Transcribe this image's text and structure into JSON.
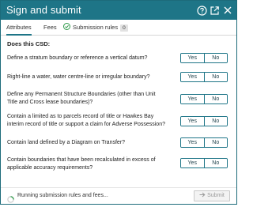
{
  "dialog": {
    "title": "Sign and submit",
    "title_icons": [
      "help-icon",
      "open-external-icon",
      "close-icon"
    ]
  },
  "tabs": [
    {
      "label": "Attributes",
      "active": true
    },
    {
      "label": "Fees",
      "active": false
    },
    {
      "label": "Submission rules",
      "active": false,
      "badge": "0",
      "icon": "check-circle-icon"
    }
  ],
  "section_label": "Does this CSD:",
  "yes_label": "Yes",
  "no_label": "No",
  "questions": [
    {
      "text": "Define a stratum boundary or reference a vertical datum?"
    },
    {
      "text": "Right-line a water, water centre-line or irregular boundary?"
    },
    {
      "text": "Define any Permanent Structure Boundaries (other than Unit Title and Cross lease boundaries)?"
    },
    {
      "text": "Contain a limited as to parcels record of title or Hawkes Bay interim record of title or support a claim for Adverse Possession?"
    },
    {
      "text": "Contain land defined by a Diagram on Transfer?"
    },
    {
      "text": "Contain boundaries that have been recalculated in excess of applicable accuracy requirements?"
    }
  ],
  "footer": {
    "status": "Running submission rules and fees...",
    "submit_label": "Submit",
    "submit_icon": "arrow-right-icon",
    "spinner_icon": "spinner-icon"
  },
  "colors": {
    "accent": "#1e7587",
    "title_text": "#ffffff",
    "submit_disabled": "#9a9a9a"
  }
}
